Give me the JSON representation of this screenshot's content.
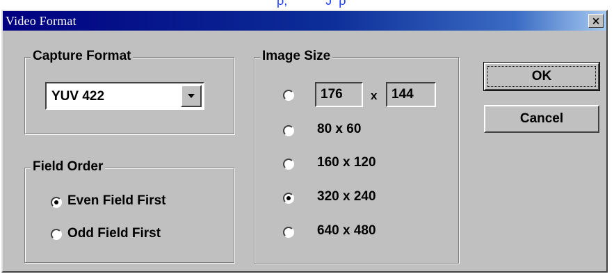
{
  "background": {
    "partial_text": "ρ,           J  ρ"
  },
  "dialog": {
    "title": "Video Format",
    "close_label": "×"
  },
  "capture_format": {
    "title": "Capture Format",
    "selected": "YUV 422"
  },
  "field_order": {
    "title": "Field Order",
    "options": [
      {
        "label": "Even Field First",
        "checked": true
      },
      {
        "label": "Odd Field First",
        "checked": false
      }
    ]
  },
  "image_size": {
    "title": "Image Size",
    "custom_width": "176",
    "custom_separator": "x",
    "custom_height": "144",
    "options": [
      {
        "label": "80 x 60",
        "checked": false
      },
      {
        "label": "160 x 120",
        "checked": false
      },
      {
        "label": "320 x 240",
        "checked": true
      },
      {
        "label": "640 x 480",
        "checked": false
      }
    ],
    "custom_checked": false
  },
  "buttons": {
    "ok": "OK",
    "cancel": "Cancel"
  },
  "colors": {
    "title_start": "#000080",
    "title_end": "#a6caf0",
    "face": "#c0c0c0"
  }
}
